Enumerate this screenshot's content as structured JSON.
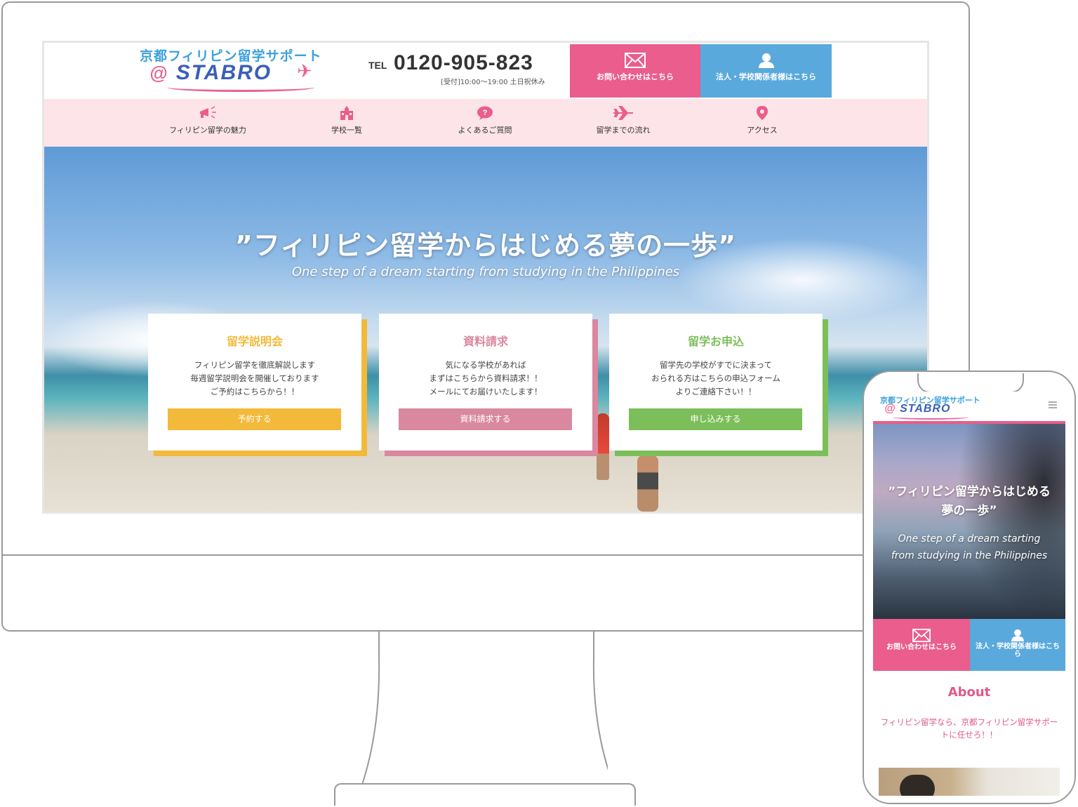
{
  "site": {
    "logo": {
      "top": "京都フィリピン留学サポート",
      "at": "@",
      "main": "STABRO"
    },
    "tel": {
      "label": "TEL",
      "number": "0120-905-823",
      "hours": "[受付]10:00～19:00 土日祝休み"
    },
    "header_buttons": {
      "contact": "お問い合わせはこちら",
      "corporate": "法人・学校関係者様はこちら"
    },
    "nav": [
      {
        "label": "フィリピン留学の魅力",
        "icon": "megaphone-icon"
      },
      {
        "label": "学校一覧",
        "icon": "school-icon"
      },
      {
        "label": "よくあるご質問",
        "icon": "question-bubble-icon"
      },
      {
        "label": "留学までの流れ",
        "icon": "airplane-icon"
      },
      {
        "label": "アクセス",
        "icon": "map-pin-icon"
      }
    ],
    "hero": {
      "title": "”フィリピン留学からはじめる夢の一歩”",
      "subtitle": "One step of a dream starting from studying in the Philippines"
    },
    "cards": [
      {
        "title": "留学説明会",
        "text": "フィリピン留学を徹底解説します\n毎週留学説明会を開催しております\nご予約はこちらから！！",
        "button": "予約する",
        "color": "#f3b93a"
      },
      {
        "title": "資料請求",
        "text": "気になる学校があれば\nまずはこちらから資料請求！！\nメールにてお届けいたします！",
        "button": "資料請求する",
        "color": "#d9889f"
      },
      {
        "title": "留学お申込",
        "text": "留学先の学校がすでに決まって\nおられる方はこちらの申込フォーム\nよりご連絡下さい！！",
        "button": "申し込みする",
        "color": "#7cbf5a"
      }
    ]
  },
  "mobile": {
    "logo": {
      "top": "京都フィリピン留学サポート",
      "at": "@",
      "main": "STABRO"
    },
    "hero": {
      "title_line1": "”フィリピン留学からはじめる",
      "title_line2": "夢の一歩”",
      "subtitle_line1": "One step of a dream starting",
      "subtitle_line2": "from studying in the Philippines"
    },
    "buttons": {
      "contact": "お問い合わせはこちら",
      "corporate": "法人・学校関係者様はこちら"
    },
    "about": {
      "heading": "About",
      "text": "フィリピン留学なら、京都フィリピン留学サポートに任せろ！！"
    }
  },
  "colors": {
    "pink": "#ea5d8c",
    "blue": "#5aa9dc",
    "nav_bg": "#fde4e8",
    "logo_blue": "#3a5fb7"
  }
}
